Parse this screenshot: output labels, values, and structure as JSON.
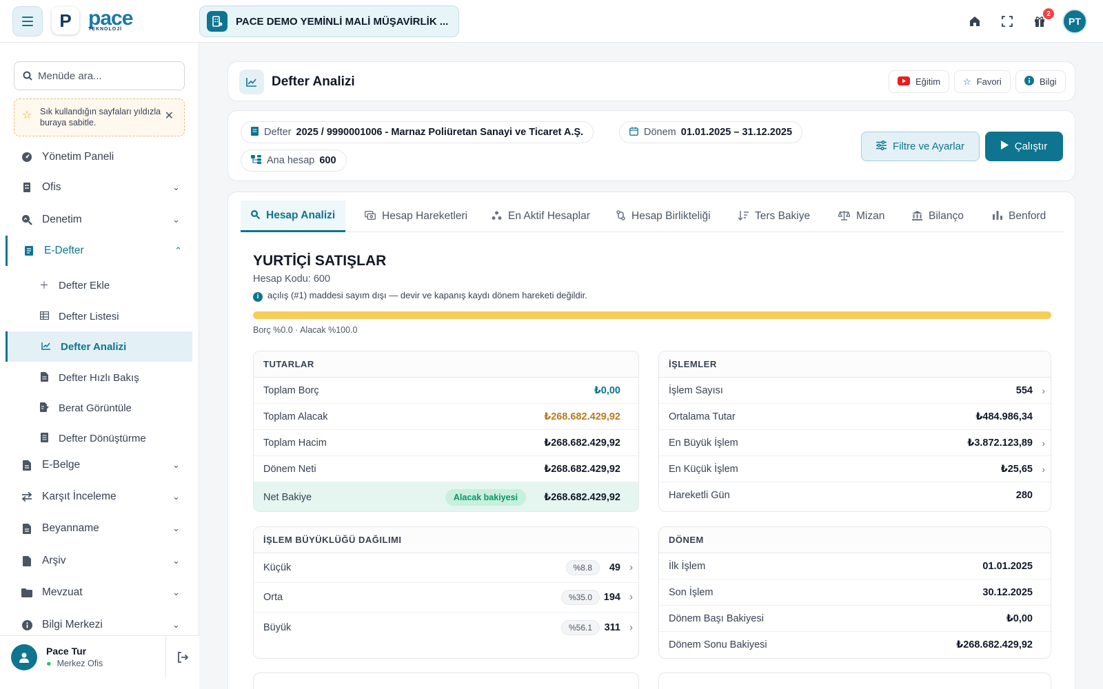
{
  "header": {
    "logo_letter": "P",
    "logo_word": "pace",
    "logo_sub": "TEKNOLOJİ",
    "company": "PACE DEMO YEMİNLİ MALİ MÜŞAVİRLİK ...",
    "notification_count": "2",
    "user_initials": "PT"
  },
  "sidebar": {
    "search_placeholder": "Menüde ara...",
    "tip": "Sık kullandığın sayfaları yıldızla buraya sabitle.",
    "items": [
      {
        "label": "Yönetim Paneli"
      },
      {
        "label": "Ofis"
      },
      {
        "label": "Denetim"
      },
      {
        "label": "E-Defter"
      },
      {
        "label": "E-Belge"
      },
      {
        "label": "Karşıt İnceleme"
      },
      {
        "label": "Beyanname"
      },
      {
        "label": "Arşiv"
      },
      {
        "label": "Mevzuat"
      },
      {
        "label": "Bilgi Merkezi"
      }
    ],
    "subitems": [
      {
        "label": "Defter Ekle"
      },
      {
        "label": "Defter Listesi"
      },
      {
        "label": "Defter Analizi"
      },
      {
        "label": "Defter Hızlı Bakış"
      },
      {
        "label": "Berat Görüntüle"
      },
      {
        "label": "Defter Dönüştürme"
      }
    ],
    "user": {
      "name": "Pace Tur",
      "office": "Merkez Ofis"
    }
  },
  "page": {
    "title": "Defter Analizi",
    "buttons": {
      "training": "Eğitim",
      "favorite": "Favori",
      "info": "Bilgi"
    }
  },
  "filters": {
    "defter_label": "Defter",
    "defter_value": "2025 / 9990001006 - Marnaz Poliüretan Sanayi ve Ticaret A.Ş.",
    "donem_label": "Dönem",
    "donem_value": "01.01.2025 – 31.12.2025",
    "ana_hesap_label": "Ana hesap",
    "ana_hesap_value": "600",
    "filter_button": "Filtre ve Ayarlar",
    "run_button": "Çalıştır"
  },
  "tabs": [
    {
      "label": "Hesap Analizi"
    },
    {
      "label": "Hesap Hareketleri"
    },
    {
      "label": "En Aktif Hesaplar"
    },
    {
      "label": "Hesap Birlikteliği"
    },
    {
      "label": "Ters Bakiye"
    },
    {
      "label": "Mizan"
    },
    {
      "label": "Bilanço"
    },
    {
      "label": "Benford"
    }
  ],
  "account": {
    "title": "YURTİÇİ SATIŞLAR",
    "code": "Hesap Kodu: 600",
    "note": "açılış (#1) maddesi sayım dışı — devir ve kapanış kaydı dönem hareketi değildir.",
    "credit_ratio": 1.0,
    "ratio_caption": "Borç %0.0 · Alacak %100.0"
  },
  "tutarlar": {
    "title": "TUTARLAR",
    "rows": [
      {
        "label": "Toplam Borç",
        "value": "₺0,00"
      },
      {
        "label": "Toplam Alacak",
        "value": "₺268.682.429,92"
      },
      {
        "label": "Toplam Hacim",
        "value": "₺268.682.429,92"
      },
      {
        "label": "Dönem Neti",
        "value": "₺268.682.429,92"
      }
    ],
    "net": {
      "label": "Net Bakiye",
      "badge": "Alacak bakiyesi",
      "value": "₺268.682.429,92"
    }
  },
  "islemler": {
    "title": "İŞLEMLER",
    "rows": [
      {
        "label": "İşlem Sayısı",
        "value": "554"
      },
      {
        "label": "Ortalama Tutar",
        "value": "₺484.986,34"
      },
      {
        "label": "En Büyük İşlem",
        "value": "₺3.872.123,89"
      },
      {
        "label": "En Küçük İşlem",
        "value": "₺25,65"
      },
      {
        "label": "Hareketli Gün",
        "value": "280"
      }
    ]
  },
  "dagilim": {
    "title": "İŞLEM BÜYÜKLÜĞÜ DAĞILIMI",
    "rows": [
      {
        "label": "Küçük",
        "pct": "%8.8",
        "value": "49"
      },
      {
        "label": "Orta",
        "pct": "%35.0",
        "value": "194"
      },
      {
        "label": "Büyük",
        "pct": "%56.1",
        "value": "311"
      }
    ]
  },
  "donem": {
    "title": "DÖNEM",
    "rows": [
      {
        "label": "İlk İşlem",
        "value": "01.01.2025"
      },
      {
        "label": "Son İşlem",
        "value": "30.12.2025"
      },
      {
        "label": "Dönem Başı Bakiyesi",
        "value": "₺0,00"
      },
      {
        "label": "Dönem Sonu Bakiyesi",
        "value": "₺268.682.429,92"
      }
    ]
  },
  "colors": {
    "primary": "#0e7490",
    "debit": "#0e7490",
    "credit": "#b7791f",
    "bar": "#f6cd58"
  }
}
